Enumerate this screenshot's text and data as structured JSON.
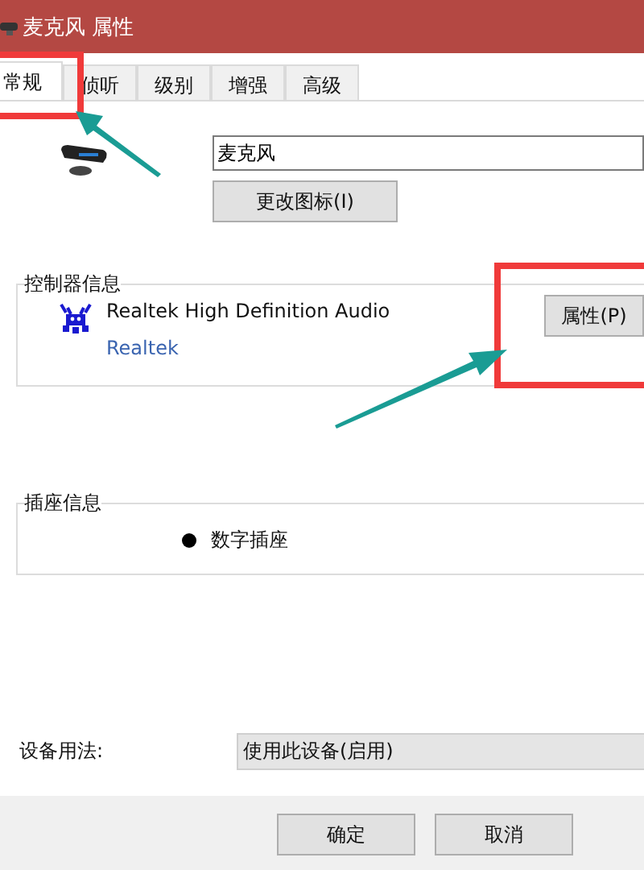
{
  "window": {
    "title": "麦克风 属性"
  },
  "tabs": [
    {
      "label": "常规",
      "selected": true
    },
    {
      "label": "侦听",
      "selected": false
    },
    {
      "label": "级别",
      "selected": false
    },
    {
      "label": "增强",
      "selected": false
    },
    {
      "label": "高级",
      "selected": false
    }
  ],
  "device_name": {
    "value": "麦克风"
  },
  "change_icon_button": "更改图标(I)",
  "controller": {
    "title": "控制器信息",
    "name": "Realtek High Definition Audio",
    "vendor_link": "Realtek",
    "properties_button": "属性(P)"
  },
  "jack": {
    "title": "插座信息",
    "items": [
      "数字插座"
    ]
  },
  "usage": {
    "label": "设备用法:",
    "value": "使用此设备(启用)"
  },
  "buttons": [
    "确定",
    "取消"
  ]
}
